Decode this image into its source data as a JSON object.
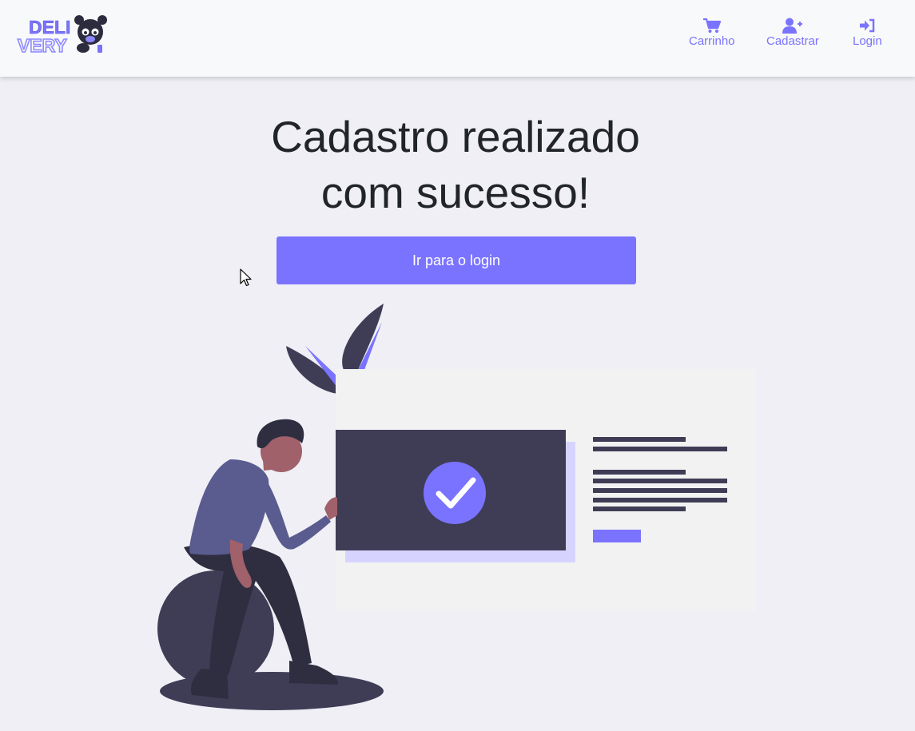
{
  "header": {
    "logo_text_top": "DELI",
    "logo_text_bottom": "VERY",
    "nav": [
      {
        "label": "Carrinho",
        "icon": "shopping-cart-icon"
      },
      {
        "label": "Cadastrar",
        "icon": "user-plus-icon"
      },
      {
        "label": "Login",
        "icon": "sign-in-icon"
      }
    ]
  },
  "main": {
    "title_line1": "Cadastro realizado",
    "title_line2": "com sucesso!",
    "login_button_label": "Ir para o login"
  },
  "colors": {
    "accent": "#7a73ff",
    "background": "#efeff5",
    "navbar": "#f8f9fa",
    "dark": "#3f3d56"
  }
}
